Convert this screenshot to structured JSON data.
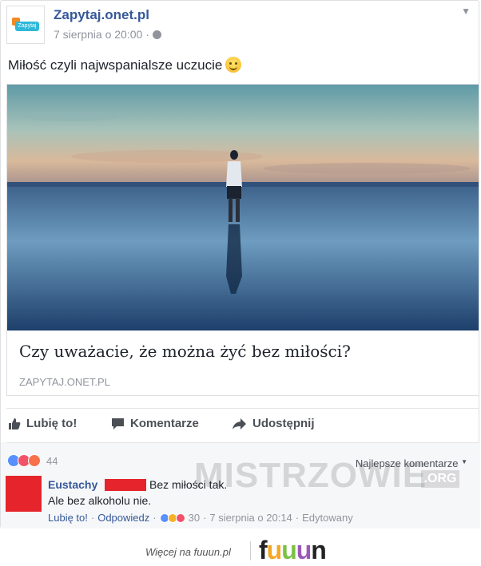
{
  "post": {
    "page_name": "Zapytaj.onet.pl",
    "avatar_text": "Zapytaj",
    "date": "7 sierpnia o 20:00 ·",
    "text": "Miłość czyli najwspanialsze uczucie"
  },
  "link_preview": {
    "title": "Czy uważacie, że można żyć bez miłości?",
    "domain": "ZAPYTAJ.ONET.PL"
  },
  "actions": {
    "like": "Lubię to!",
    "comment": "Komentarze",
    "share": "Udostępnij"
  },
  "reactions": {
    "count": "44",
    "sort_label": "Najlepsze komentarze"
  },
  "comment": {
    "author": "Eustachy",
    "line1": "Bez miłości tak.",
    "line2": "Ale bez alkoholu nie.",
    "like_link": "Lubię to!",
    "reply_link": "Odpowiedz",
    "reaction_count": "30",
    "timestamp": "7 sierpnia o 20:14",
    "edited": "Edytowany"
  },
  "watermark": {
    "text": "MISTRZOWIE",
    "suffix": ".ORG"
  },
  "footer": {
    "more_text": "Więcej na fuuun.pl",
    "logo_letters": [
      "f",
      "u",
      "u",
      "u",
      "n"
    ],
    "logo_colors": [
      "#222222",
      "#f5a623",
      "#7ac143",
      "#9b59b6",
      "#222222"
    ]
  },
  "colors": {
    "link_blue": "#365899",
    "muted": "#90949c",
    "like_blue": "#5890ff",
    "love_red": "#f25268",
    "angry_orange": "#f7714b",
    "haha_yellow": "#f7b125"
  }
}
